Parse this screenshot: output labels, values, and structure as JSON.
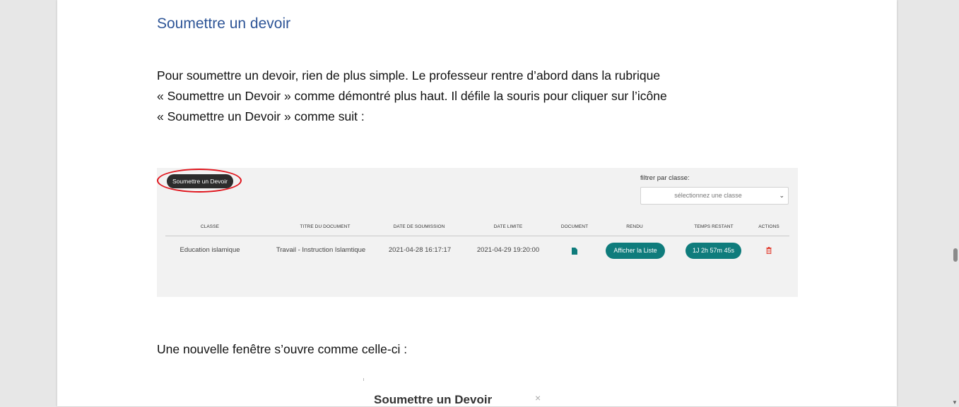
{
  "document": {
    "heading": "Soumettre un devoir",
    "paragraph_lines": [
      "Pour soumettre un devoir, rien de plus simple. Le professeur rentre d’abord dans la rubrique",
      "« Soumettre un Devoir » comme démontré plus haut. Il défile la souris pour cliquer sur l’icône",
      "« Soumettre un Devoir » comme suit :"
    ],
    "paragraph2": "Une nouvelle fenêtre s’ouvre comme celle-ci :"
  },
  "screenshot1": {
    "submit_button": "Soumettre un Devoir",
    "filter_label": "filtrer par classe:",
    "filter_placeholder": "sélectionnez une classe",
    "highlight_color": "#e0141c",
    "accent_color": "#0f7c7c",
    "columns": [
      "CLASSE",
      "TITRE DU DOCUMENT",
      "DATE DE SOUMISSION",
      "DATE LIMITE",
      "DOCUMENT",
      "RENDU",
      "TEMPS RESTANT",
      "ACTIONS"
    ],
    "row": {
      "classe": "Education islamique",
      "titre": "Travail - Instruction Islamtique",
      "date_soumission": "2021-04-28 16:17:17",
      "date_limite": "2021-04-29 19:20:00",
      "document_icon": "file-icon",
      "rendu_button": "Afficher la Liste",
      "temps_restant": "1J 2h 57m 45s",
      "action_icon": "trash-icon"
    }
  },
  "screenshot2": {
    "modal_title": "Soumettre un Devoir",
    "close_symbol": "×"
  }
}
